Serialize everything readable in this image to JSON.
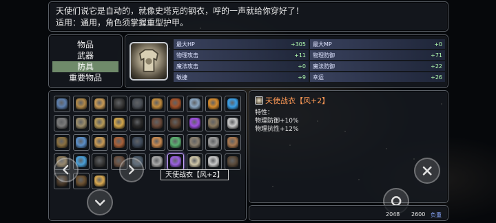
{
  "description": {
    "line1": "天使们说它是自动的，就像史塔克的钢衣，呼的一声就给你穿好了！",
    "line2": "适用：通用，角色须掌握重型护甲。"
  },
  "categories": [
    {
      "label": "物品",
      "selected": false
    },
    {
      "label": "武器",
      "selected": false
    },
    {
      "label": "防具",
      "selected": true
    },
    {
      "label": "重要物品",
      "selected": false
    }
  ],
  "stats": [
    {
      "label": "最大HP",
      "value": "+305"
    },
    {
      "label": "最大MP",
      "value": "+0"
    },
    {
      "label": "物理攻击",
      "value": "+11"
    },
    {
      "label": "物理防御",
      "value": "+71"
    },
    {
      "label": "魔法攻击",
      "value": "+0"
    },
    {
      "label": "魔法防御",
      "value": "+22"
    },
    {
      "label": "敏捷",
      "value": "+9"
    },
    {
      "label": "幸运",
      "value": "+26"
    }
  ],
  "inventory": {
    "items": [
      {
        "color": "#5d7fae",
        "icon": "shield-icon"
      },
      {
        "color": "#b08848",
        "icon": "armor-icon"
      },
      {
        "color": "#c89a55",
        "icon": "armor-icon"
      },
      {
        "color": "#3a3a3a",
        "icon": "cloak-icon"
      },
      {
        "color": "#4a4f56",
        "icon": "helmet-icon"
      },
      {
        "color": "#c28c3e",
        "icon": "armor-icon"
      },
      {
        "color": "#a05028",
        "icon": "armor-icon"
      },
      {
        "color": "#8aa6c0",
        "icon": "orb-icon"
      },
      {
        "color": "#d48a2c",
        "icon": "armor-icon"
      },
      {
        "color": "#3aa0e8",
        "icon": "ring-icon"
      },
      {
        "color": "#7a7a7a",
        "icon": "helmet-icon"
      },
      {
        "color": "#9a8c6a",
        "icon": "armor-icon"
      },
      {
        "color": "#b89b58",
        "icon": "armor-icon"
      },
      {
        "color": "#d2a64a",
        "icon": "ring-icon"
      },
      {
        "color": "#2a2a2a",
        "icon": "cloak-icon"
      },
      {
        "color": "#6a4a3a",
        "icon": "boots-icon"
      },
      {
        "color": "#5a4030",
        "icon": "boots-icon"
      },
      {
        "color": "#a050e0",
        "icon": "crown-icon"
      },
      {
        "color": "#8a7a60",
        "icon": "armor-icon"
      },
      {
        "color": "#c8c8c8",
        "icon": "helmet-icon"
      },
      {
        "color": "#8a7040",
        "icon": "armor-icon"
      },
      {
        "color": "#5a8ec8",
        "icon": "armor-icon"
      },
      {
        "color": "#c89a55",
        "icon": "gloves-icon"
      },
      {
        "color": "#a86038",
        "icon": "gloves-icon"
      },
      {
        "color": "#3e4a5a",
        "icon": "boots-icon"
      },
      {
        "color": "#c88a50",
        "icon": "gloves-icon"
      },
      {
        "color": "#5ab070",
        "icon": "ring-icon"
      },
      {
        "color": "#8a8070",
        "icon": "helmet-icon"
      },
      {
        "color": "#9a9a9a",
        "icon": "helmet-icon"
      },
      {
        "color": "#a87850",
        "icon": "armor-icon"
      },
      {
        "color": "#8c7a5a",
        "icon": "armor-icon"
      },
      {
        "color": "#4aa0d8",
        "icon": "armor-icon"
      },
      {
        "color": "#3a3a3a",
        "icon": "belt-icon"
      },
      {
        "color": "#6a5040",
        "icon": "boots-icon"
      },
      {
        "color": "#4a5a6a",
        "icon": "belt-icon"
      },
      {
        "color": "#aaaaaa",
        "icon": "ring-icon"
      },
      {
        "color": "#9a60e0",
        "icon": "armor-icon"
      },
      {
        "color": "#cfc6a8",
        "icon": "armor-icon"
      },
      {
        "color": "#c8c8c8",
        "icon": "ring-icon"
      },
      {
        "color": "#5a4a3a",
        "icon": "armor-icon"
      },
      {
        "color": "#4a3a2a",
        "icon": "armor-icon"
      },
      {
        "color": "#6a5030",
        "icon": "armor-icon"
      },
      {
        "color": "#d8a850",
        "icon": "ring-icon"
      }
    ],
    "selected_index": 36,
    "tooltip": "天使战衣【风+2】"
  },
  "detail": {
    "name": "天使战衣【风+2】",
    "traits_label": "特性：",
    "traits": [
      "物理防御+10%",
      "物理抗性+12%"
    ]
  },
  "footer": {
    "weight_current": "2048",
    "weight_max": "2600",
    "weight_label": "负重"
  },
  "colors": {
    "selected_category": "#6f8a6a",
    "detail_title": "#ff9a55",
    "stat_value": "#b4ffb0"
  }
}
